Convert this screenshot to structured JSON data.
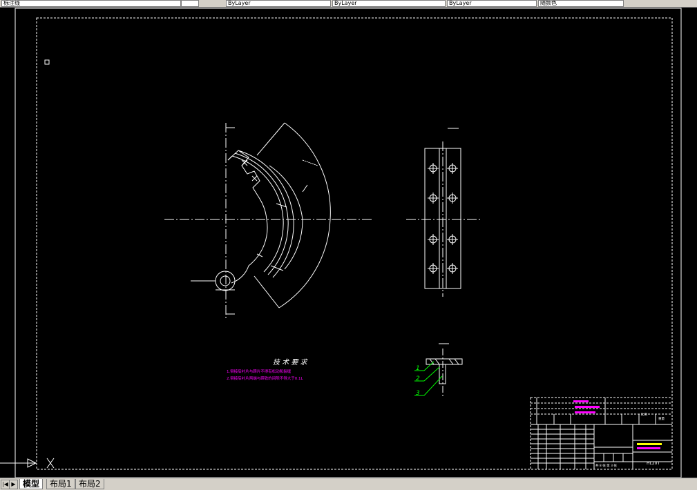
{
  "toolbar": {
    "fields": [
      "标注线",
      "ByLayer",
      "ByLayer",
      "ByLayer",
      "随颜色"
    ]
  },
  "drawing": {
    "tech_title": "技 术 要 求",
    "tech_notes": [
      "1.铆接后衬片与蹄片不得有松动和裂缝",
      "2.铆接后衬片两端与蹄铁的间隙不得大于0.1L"
    ],
    "balloons": [
      "1",
      "2",
      "3"
    ],
    "title_block": {
      "drawing_no": "HL20T",
      "sheet": "共 8 张  第 3 张",
      "stage": "阶段标记",
      "weight": "重量",
      "scale": "比例",
      "headers": [
        "标",
        "记",
        "处",
        "数",
        "分",
        "区",
        "更改文件号",
        "签 名",
        "年月日"
      ]
    }
  },
  "tabs": {
    "model": "模型",
    "layout1": "布局1",
    "layout2": "布局2"
  },
  "nav": [
    "|◀",
    "◀",
    "▶",
    "▶|"
  ],
  "colors": {
    "background": "#000000",
    "line": "#ffffff",
    "notes": "#ff00ff",
    "balloons": "#00ff00",
    "highlight": "#ffff00"
  }
}
